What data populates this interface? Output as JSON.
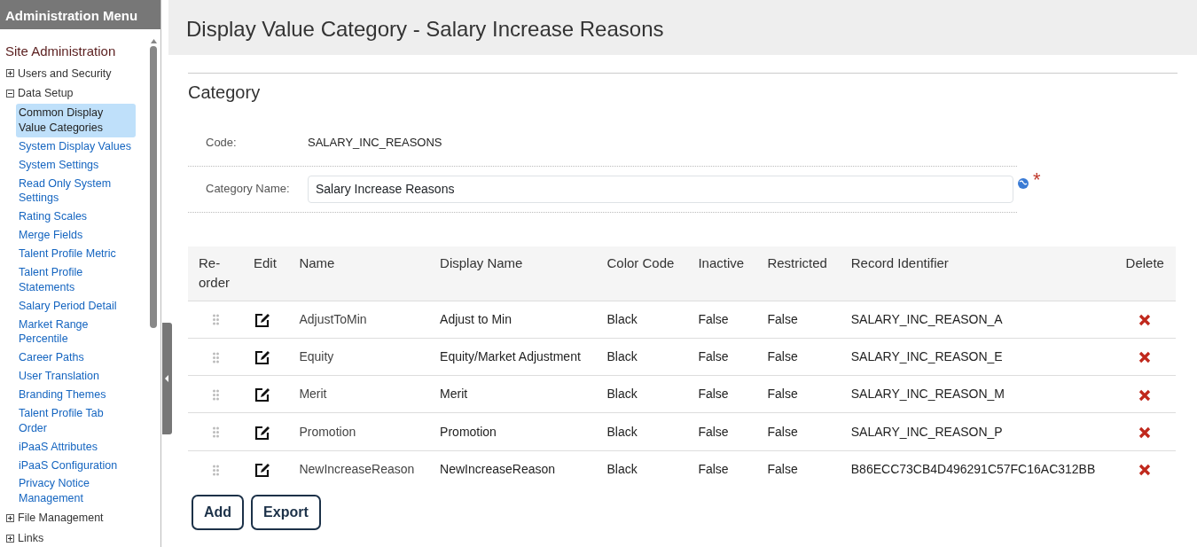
{
  "sidebar": {
    "header": "Administration Menu",
    "section_title": "Site Administration",
    "items": [
      {
        "label": "Users and Security",
        "expanded": false
      },
      {
        "label": "Data Setup",
        "expanded": true,
        "children": [
          {
            "label": "Common Display Value Categories",
            "selected": true
          },
          {
            "label": "System Display Values",
            "selected": false
          },
          {
            "label": "System Settings",
            "selected": false
          },
          {
            "label": "Read Only System Settings",
            "selected": false
          },
          {
            "label": "Rating Scales",
            "selected": false
          },
          {
            "label": "Merge Fields",
            "selected": false
          },
          {
            "label": "Talent Profile Metric",
            "selected": false
          },
          {
            "label": "Talent Profile Statements",
            "selected": false
          },
          {
            "label": "Salary Period Detail",
            "selected": false
          },
          {
            "label": "Market Range Percentile",
            "selected": false
          },
          {
            "label": "Career Paths",
            "selected": false
          },
          {
            "label": "User Translation",
            "selected": false
          },
          {
            "label": "Branding Themes",
            "selected": false
          },
          {
            "label": "Talent Profile Tab Order",
            "selected": false
          },
          {
            "label": "iPaaS Attributes",
            "selected": false
          },
          {
            "label": "iPaaS Configuration",
            "selected": false
          },
          {
            "label": "Privacy Notice Management",
            "selected": false
          }
        ]
      },
      {
        "label": "File Management",
        "expanded": false
      },
      {
        "label": "Links",
        "expanded": false
      }
    ]
  },
  "page_title": "Display Value Category - Salary Increase Reasons",
  "section_title": "Category",
  "form": {
    "code_label": "Code:",
    "code_value": "SALARY_INC_REASONS",
    "name_label": "Category Name:",
    "name_value": "Salary Increase Reasons",
    "required_marker": "*"
  },
  "table": {
    "columns": [
      "Re-order",
      "Edit",
      "Name",
      "Display Name",
      "Color Code",
      "Inactive",
      "Restricted",
      "Record Identifier",
      "Delete"
    ],
    "rows": [
      {
        "name": "AdjustToMin",
        "display_name": "Adjust to Min",
        "color_code": "Black",
        "inactive": "False",
        "restricted": "False",
        "record_identifier": "SALARY_INC_REASON_A"
      },
      {
        "name": "Equity",
        "display_name": "Equity/Market Adjustment",
        "color_code": "Black",
        "inactive": "False",
        "restricted": "False",
        "record_identifier": "SALARY_INC_REASON_E"
      },
      {
        "name": "Merit",
        "display_name": "Merit",
        "color_code": "Black",
        "inactive": "False",
        "restricted": "False",
        "record_identifier": "SALARY_INC_REASON_M"
      },
      {
        "name": "Promotion",
        "display_name": "Promotion",
        "color_code": "Black",
        "inactive": "False",
        "restricted": "False",
        "record_identifier": "SALARY_INC_REASON_P"
      },
      {
        "name": "NewIncreaseReason",
        "display_name": "NewIncreaseReason",
        "color_code": "Black",
        "inactive": "False",
        "restricted": "False",
        "record_identifier": "B86ECC73CB4D496291C57FC16AC312BB"
      }
    ]
  },
  "buttons": [
    "Add",
    "Export"
  ]
}
